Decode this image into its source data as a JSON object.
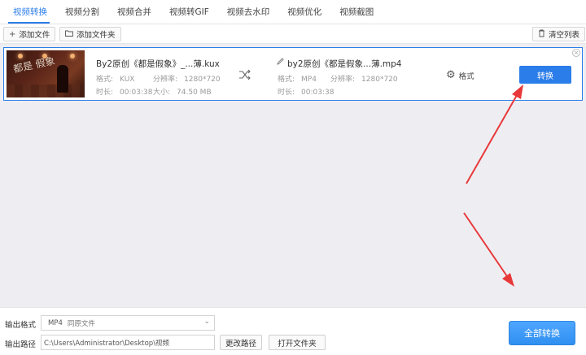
{
  "tabs": [
    {
      "label": "视频转换",
      "active": true
    },
    {
      "label": "视频分割"
    },
    {
      "label": "视频合并"
    },
    {
      "label": "视频转GIF"
    },
    {
      "label": "视频去水印"
    },
    {
      "label": "视频优化"
    },
    {
      "label": "视频截图"
    }
  ],
  "toolbar": {
    "add_file": "添加文件",
    "add_folder": "添加文件夹",
    "clear_list": "清空列表"
  },
  "item": {
    "thumb_title": "都是 假象",
    "source": {
      "name": "By2原创《都是假象》_...薄.kux",
      "format_label": "格式:",
      "format": "KUX",
      "resolution_label": "分辨率:",
      "resolution": "1280*720",
      "duration_label": "时长:",
      "duration": "00:03:38",
      "size_label": "大小:",
      "size": "74.50 MB"
    },
    "output": {
      "name": "by2原创《都是假象...薄.mp4",
      "format_label": "格式:",
      "format": "MP4",
      "resolution_label": "分辨率:",
      "resolution": "1280*720",
      "duration_label": "时长:",
      "duration": "00:03:38"
    },
    "format_settings": "格式",
    "convert": "转换"
  },
  "bottom": {
    "output_format_label": "输出格式",
    "format_value": "MP4",
    "format_sub": "同原文件",
    "output_path_label": "输出路径",
    "path_value": "C:\\Users\\Administrator\\Desktop\\视频",
    "change_path": "更改路径",
    "open_folder": "打开文件夹",
    "convert_all": "全部转换"
  },
  "colors": {
    "accent": "#2b7de9",
    "annotation_arrow": "#e8383a"
  }
}
